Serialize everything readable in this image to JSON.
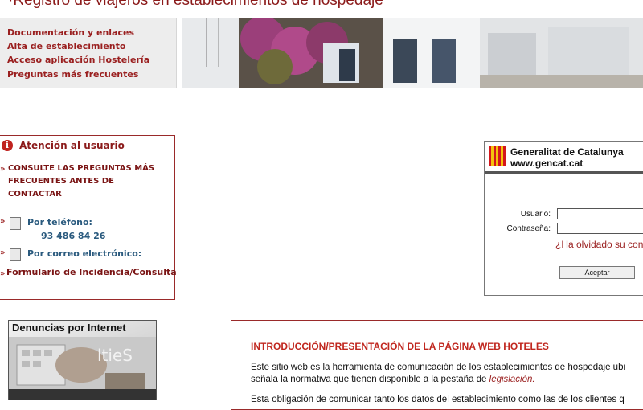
{
  "header": {
    "title": "·Registro de viajeros en establecimientos de hospedaje"
  },
  "nav": {
    "items": [
      {
        "label": "Documentación y enlaces"
      },
      {
        "label": "Alta de establecimiento"
      },
      {
        "label": "Acceso aplicación Hostelería"
      },
      {
        "label": "Preguntas más frecuentes"
      }
    ]
  },
  "attention": {
    "title": "Atención al usuario",
    "faq_line1": "CONSULTE LAS PREGUNTAS MÁS",
    "faq_line2": "FRECUENTES ANTES DE",
    "faq_line3": "CONTACTAR",
    "phone_label": "Por teléfono:",
    "phone_number": "93 486 84 26",
    "email_label": "Por correo electrónico:",
    "form_link": "Formulario de Incidencia/Consulta"
  },
  "login": {
    "org_name": "Generalitat de Catalunya",
    "org_url": "www.gencat.cat",
    "user_label": "Usuario:",
    "password_label": "Contraseña:",
    "user_value": "",
    "password_value": "",
    "forgot_link": "¿Ha olvidado su con",
    "submit_label": "Aceptar"
  },
  "promo": {
    "title": "Denuncias por Internet"
  },
  "intro": {
    "title": "INTRODUCCIÓN/PRESENTACIÓN DE LA PÁGINA WEB HOTELES",
    "line1": "Este sitio web es la herramienta de comunicación de los establecimientos de hospedaje ubi",
    "line2_pre": "señala la normativa que tienen disponible a la pestaña de ",
    "line2_link": "legislación.",
    "line3": "Esta obligación de comunicar tanto los datos del establecimiento como las de los clientes q"
  },
  "colors": {
    "brand_red": "#9a1f1f",
    "accent_blue": "#2a5a7e",
    "intro_red": "#c0271f"
  }
}
